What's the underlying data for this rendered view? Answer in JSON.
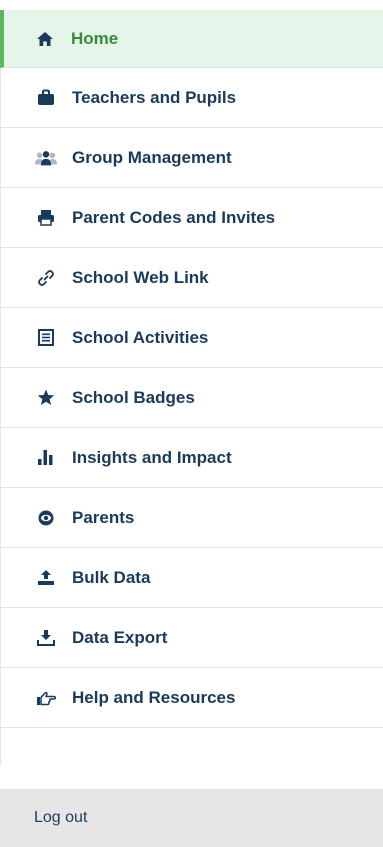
{
  "nav": {
    "items": [
      {
        "label": "Home",
        "icon": "home-icon"
      },
      {
        "label": "Teachers and Pupils",
        "icon": "briefcase-icon"
      },
      {
        "label": "Group Management",
        "icon": "users-icon"
      },
      {
        "label": "Parent Codes and Invites",
        "icon": "printer-icon"
      },
      {
        "label": "School Web Link",
        "icon": "link-icon"
      },
      {
        "label": "School Activities",
        "icon": "list-icon"
      },
      {
        "label": "School Badges",
        "icon": "star-icon"
      },
      {
        "label": "Insights and Impact",
        "icon": "bar-chart-icon"
      },
      {
        "label": "Parents",
        "icon": "eye-icon"
      },
      {
        "label": "Bulk Data",
        "icon": "upload-icon"
      },
      {
        "label": "Data Export",
        "icon": "download-icon"
      },
      {
        "label": "Help and Resources",
        "icon": "pointing-hand-icon"
      }
    ],
    "active_index": 0
  },
  "footer": {
    "logout_label": "Log out"
  },
  "colors": {
    "accent_green": "#5cb85c",
    "active_background": "#e5f5e9",
    "active_text": "#3a8a3a",
    "label_text": "#1a3a5c",
    "footer_background": "#e6e6e6"
  }
}
